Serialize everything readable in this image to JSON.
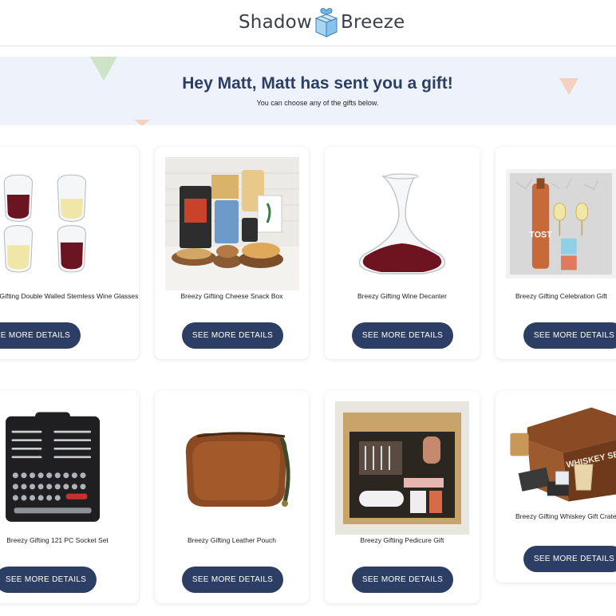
{
  "brand": {
    "left": "Shadow",
    "right": "Breeze"
  },
  "banner": {
    "greeting": "Hey Matt, Matt has sent you a gift!",
    "subtitle": "You can choose any of the gifts below."
  },
  "gifts": [
    {
      "name": "Breezy Gifting Double Walled Stemless Wine Glasses",
      "button": "SEE MORE DETAILS"
    },
    {
      "name": "Breezy Gifting Cheese Snack Box",
      "button": "SEE MORE DETAILS"
    },
    {
      "name": "Breezy Gifting Wine Decanter",
      "button": "SEE MORE DETAILS"
    },
    {
      "name": "Breezy Gifting Celebration Gift",
      "button": "SEE MORE DETAILS"
    },
    {
      "name": "Breezy Gifting 121 PC Socket Set",
      "button": "SEE MORE DETAILS"
    },
    {
      "name": "Breezy Gifting Leather Pouch",
      "button": "SEE MORE DETAILS"
    },
    {
      "name": "Breezy Gifting Pedicure Gift",
      "button": "SEE MORE DETAILS"
    },
    {
      "name": "Breezy Gifting Whiskey Gift Crate",
      "button": "SEE MORE DETAILS"
    }
  ],
  "image_labels": {
    "tost": "TOST",
    "whiskey": "WHISKEY SET"
  },
  "colors": {
    "primary": "#2c3e63",
    "banner_bg": "#eef3fb",
    "accent_green": "#cfe3c6",
    "accent_peach": "#f5d2c0"
  }
}
